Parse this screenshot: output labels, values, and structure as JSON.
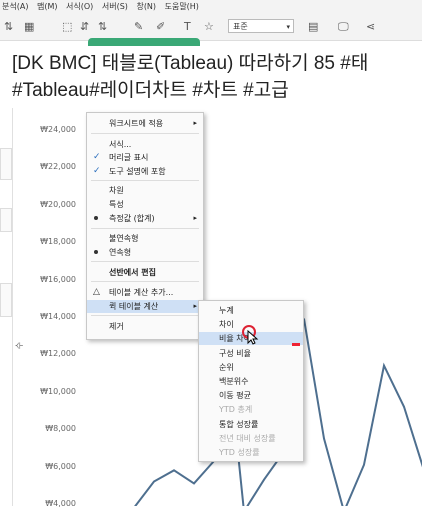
{
  "menubar": [
    "분석(A)",
    "맵(M)",
    "서식(O)",
    "서버(S)",
    "창(N)",
    "도움말(H)"
  ],
  "toolbar": {
    "font_combo": "표준"
  },
  "banner": {
    "line1": "[DK BMC] 태블로(Tableau) 따라하기 85 #태",
    "line2": "#Tableau#레이더차트 #차트  #고급"
  },
  "chart": {
    "y_axis_label": "수"
  },
  "chart_data": {
    "type": "line",
    "yticks": [
      "₩24,000",
      "₩22,000",
      "₩20,000",
      "₩18,000",
      "₩16,000",
      "₩14,000",
      "₩12,000",
      "₩10,000",
      "₩8,000",
      "₩6,000",
      "₩4,000"
    ],
    "ylim": [
      4000,
      24000
    ],
    "grid": false,
    "series": [
      {
        "color": "#4e6f8f",
        "values": [
          [
            0,
            3800
          ],
          [
            2,
            5200
          ],
          [
            4,
            5800
          ],
          [
            6,
            5100
          ],
          [
            8,
            6300
          ],
          [
            10,
            8800
          ],
          [
            11,
            3600
          ],
          [
            13,
            5300
          ],
          [
            15,
            6800
          ],
          [
            17,
            13900
          ],
          [
            19,
            7500
          ],
          [
            21,
            3600
          ],
          [
            23,
            6100
          ],
          [
            25,
            11400
          ],
          [
            27,
            9200
          ],
          [
            29,
            5800
          ]
        ]
      }
    ]
  },
  "context_menu": {
    "items": [
      {
        "label": "워크시트에 적용",
        "arrow": "▸",
        "checked": false
      },
      {
        "label": "서식...",
        "checked": false
      },
      {
        "label": "머리글 표시",
        "checked": true,
        "check": "✓"
      },
      {
        "label": "도구 설명에 포함",
        "checked": true,
        "check": "✓"
      },
      {
        "label": "차원",
        "checked": false
      },
      {
        "label": "특성",
        "checked": false
      },
      {
        "label": "측정값 (합계)",
        "radio": true,
        "arrow": "▸"
      },
      {
        "label": "불연속형",
        "checked": false
      },
      {
        "label": "연속형",
        "radio": true
      },
      {
        "label": "선반에서 편집",
        "bold": true
      },
      {
        "label": "테이블 계산 추가...",
        "icon": "△"
      },
      {
        "label": "퀵 테이블 계산",
        "arrow": "▸",
        "selected": true
      },
      {
        "label": "제거"
      }
    ]
  },
  "submenu": {
    "items": [
      {
        "label": "누계"
      },
      {
        "label": "차이"
      },
      {
        "label": "비율 차이",
        "selected": true
      },
      {
        "label": "구성 비율"
      },
      {
        "label": "순위"
      },
      {
        "label": "백분위수"
      },
      {
        "label": "이동 평균"
      },
      {
        "label": "YTD 총계",
        "disabled": true
      },
      {
        "label": "통합 성장률"
      },
      {
        "label": "전년 대비 성장률",
        "disabled": true
      },
      {
        "label": "YTD 성장률",
        "disabled": true
      }
    ]
  }
}
